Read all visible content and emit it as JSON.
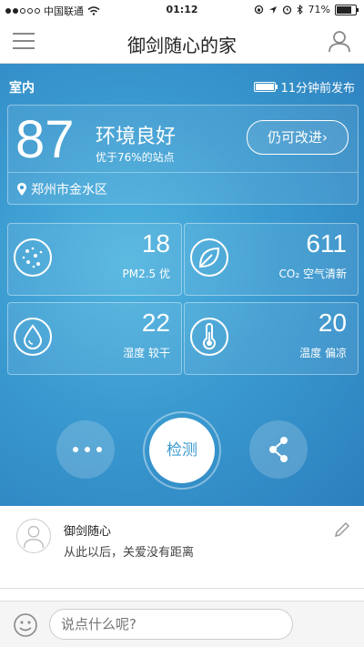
{
  "status_bar": {
    "carrier": "中国联通",
    "time": "01:12",
    "battery": "71%"
  },
  "header": {
    "title": "御剑随心的家"
  },
  "panel": {
    "room": "室内",
    "updated": "11分钟前发布",
    "score": "87",
    "quality": "环境良好",
    "rank": "优于76%的站点",
    "improve_button": "仍可改进",
    "location": "郑州市金水区",
    "metrics": [
      {
        "value": "18",
        "label": "PM2.5 优",
        "icon": "particles-icon"
      },
      {
        "value": "611",
        "label": "CO₂ 空气清新",
        "icon": "leaf-icon"
      },
      {
        "value": "22",
        "label": "湿度 较干",
        "icon": "water-drop-icon"
      },
      {
        "value": "20",
        "label": "温度 偏凉",
        "icon": "thermometer-icon"
      }
    ],
    "detect_button": "检测"
  },
  "post": {
    "author": "御剑随心",
    "message": "从此以后，关爱没有距离"
  },
  "comment": {
    "placeholder": "说点什么呢?"
  },
  "colors": {
    "panel_center": "#4fb4df",
    "panel_edge": "#2c7fbd",
    "detect_text": "#3a9ad0"
  }
}
